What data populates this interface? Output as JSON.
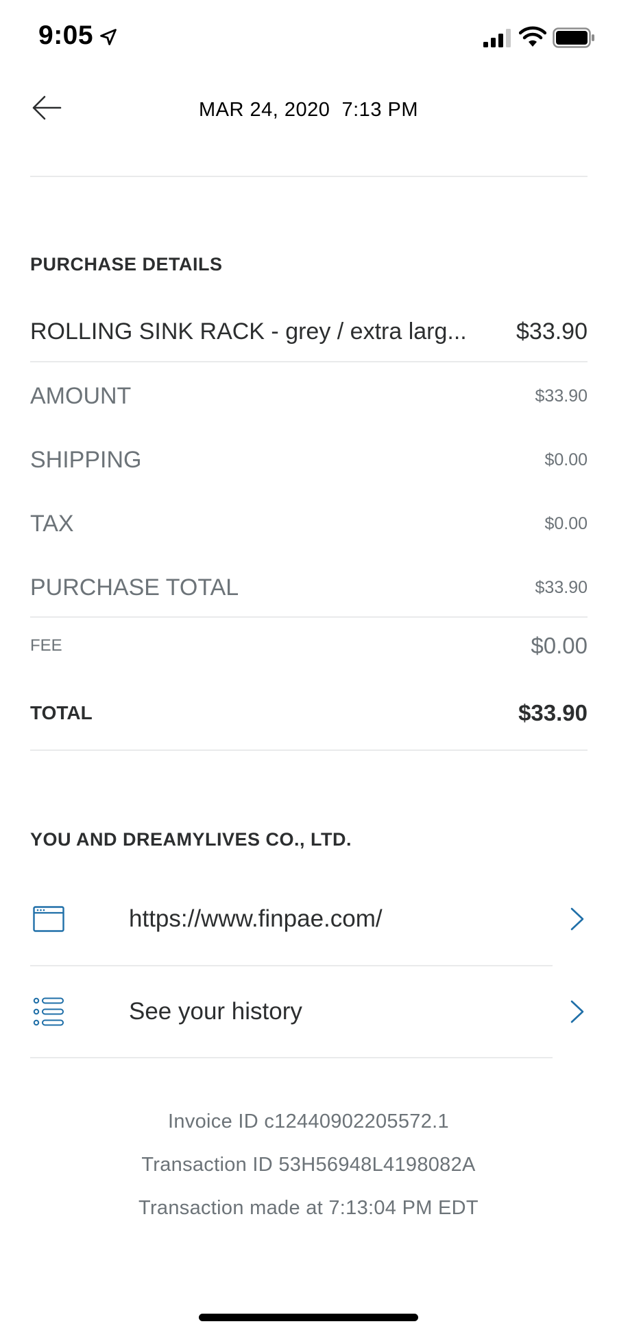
{
  "status_bar": {
    "time": "9:05",
    "icons": [
      "location-arrow-icon",
      "cellular-signal-icon",
      "wifi-icon",
      "battery-icon"
    ]
  },
  "header": {
    "title": "MAR 24, 2020  7:13 PM",
    "back_icon": "back-arrow-icon"
  },
  "purchase_details": {
    "heading": "PURCHASE DETAILS",
    "item": {
      "name": "ROLLING SINK RACK - grey / extra larg...",
      "price": "$33.90"
    },
    "breakdown": [
      {
        "label": "AMOUNT",
        "value": "$33.90"
      },
      {
        "label": "SHIPPING",
        "value": "$0.00"
      },
      {
        "label": "TAX",
        "value": "$0.00"
      },
      {
        "label": "PURCHASE TOTAL",
        "value": "$33.90"
      }
    ],
    "fee": {
      "label": "FEE",
      "value": "$0.00"
    },
    "total": {
      "label": "TOTAL",
      "value": "$33.90"
    }
  },
  "merchant": {
    "heading": "YOU AND DREAMYLIVES CO., LTD.",
    "links": [
      {
        "icon": "browser-window-icon",
        "label": "https://www.finpae.com/"
      },
      {
        "icon": "list-icon",
        "label": "See your history"
      }
    ]
  },
  "transaction_info": {
    "invoice": "Invoice ID c12440902205572.1",
    "transaction_id": "Transaction ID 53H56948L4198082A",
    "made_at": "Transaction made at 7:13:04 PM EDT"
  },
  "colors": {
    "text_primary": "#2c2e2f",
    "text_secondary": "#6c7378",
    "divider": "#e9eaeb",
    "accent_icon": "#1f6fa8"
  }
}
